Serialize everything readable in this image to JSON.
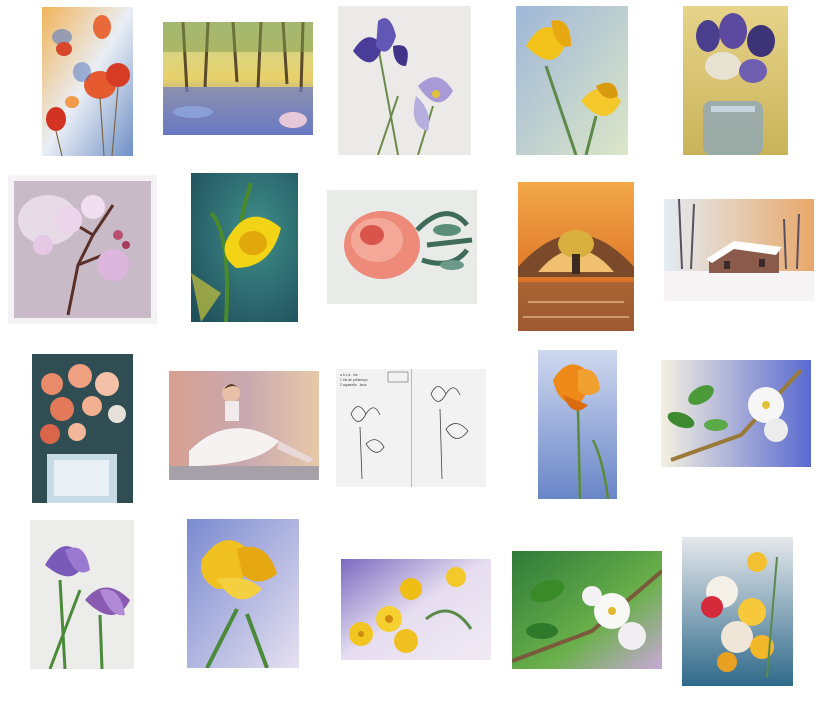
{
  "gallery": {
    "thumbnails": [
      {
        "id": 1,
        "subject": "red-poppies"
      },
      {
        "id": 2,
        "subject": "forest-bluebells"
      },
      {
        "id": 3,
        "subject": "purple-irises"
      },
      {
        "id": 4,
        "subject": "yellow-irises"
      },
      {
        "id": 5,
        "subject": "purple-flowers-vase"
      },
      {
        "id": 6,
        "subject": "pink-blossom-branch"
      },
      {
        "id": 7,
        "subject": "yellow-daffodil"
      },
      {
        "id": 8,
        "subject": "pink-peony"
      },
      {
        "id": 9,
        "subject": "bridge-figure-umbrella"
      },
      {
        "id": 10,
        "subject": "snowy-village"
      },
      {
        "id": 11,
        "subject": "roses-vase"
      },
      {
        "id": 12,
        "subject": "seated-ballerina"
      },
      {
        "id": 13,
        "subject": "iris-pencil-sketch"
      },
      {
        "id": 14,
        "subject": "orange-iris"
      },
      {
        "id": 15,
        "subject": "white-blossom-green-leaves"
      },
      {
        "id": 16,
        "subject": "purple-irises-vertical"
      },
      {
        "id": 17,
        "subject": "yellow-iris-close"
      },
      {
        "id": 18,
        "subject": "yellow-primroses"
      },
      {
        "id": 19,
        "subject": "white-flowers-green"
      },
      {
        "id": 20,
        "subject": "yellow-red-orchids"
      }
    ],
    "sketch_note": {
      "line1": "a b c d - iris",
      "line2": "1 iris de printemps",
      "line3": "2 aquarelle - lavis"
    }
  }
}
